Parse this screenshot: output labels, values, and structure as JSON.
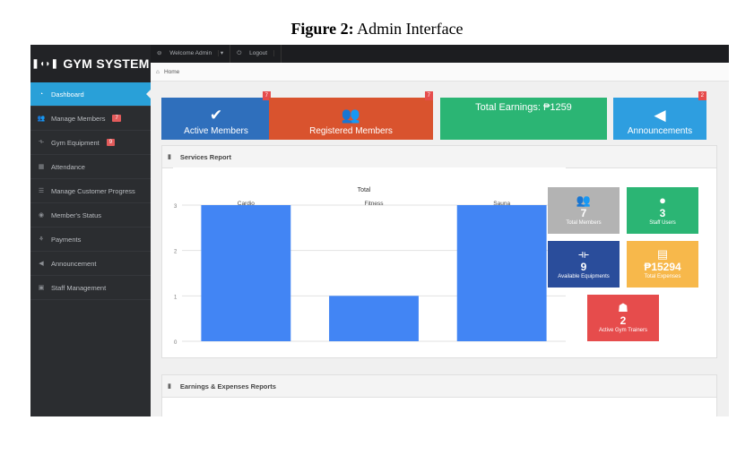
{
  "caption": {
    "label": "Figure 2:",
    "text": "Admin Interface"
  },
  "sidebar": {
    "logo": "GYM SYSTEM",
    "items": [
      {
        "label": "Dashboard",
        "icon": "dashboard-icon",
        "badge": ""
      },
      {
        "label": "Manage Members",
        "icon": "users-icon",
        "badge": "7"
      },
      {
        "label": "Gym Equipment",
        "icon": "dumbbell-icon",
        "badge": "9"
      },
      {
        "label": "Attendance",
        "icon": "calendar-icon",
        "badge": ""
      },
      {
        "label": "Manage Customer Progress",
        "icon": "tasks-icon",
        "badge": ""
      },
      {
        "label": "Member's Status",
        "icon": "eye-icon",
        "badge": ""
      },
      {
        "label": "Payments",
        "icon": "hand-money-icon",
        "badge": ""
      },
      {
        "label": "Announcement",
        "icon": "bullhorn-icon",
        "badge": ""
      },
      {
        "label": "Staff Management",
        "icon": "briefcase-icon",
        "badge": ""
      }
    ]
  },
  "topbar": {
    "welcome": "Welcome Admin",
    "logout": "Logout"
  },
  "breadcrumb": {
    "home": "Home"
  },
  "stats": [
    {
      "label": "Active Members",
      "badge": "7",
      "color": "#2f6fbc",
      "icon": "user-check-icon"
    },
    {
      "label": "Registered Members",
      "badge": "7",
      "color": "#d9532e",
      "icon": "users-icon"
    },
    {
      "label": "Total Earnings: ₱1259",
      "badge": "",
      "color": "#2bb574",
      "icon": ""
    },
    {
      "label": "Announcements",
      "badge": "2",
      "color": "#2e9ee0",
      "icon": "bullhorn-icon"
    }
  ],
  "services_panel": {
    "title": "Services Report"
  },
  "earnings_panel": {
    "title": "Earnings & Expenses Reports"
  },
  "chart_data": {
    "type": "bar",
    "title": "Total",
    "categories": [
      "Cardio",
      "Fitness",
      "Sauna"
    ],
    "values": [
      3,
      1,
      3
    ],
    "yticks": [
      "0",
      "1",
      "2",
      "3"
    ],
    "ylim": [
      0,
      3
    ],
    "bar_color": "#4285f4"
  },
  "tiles": [
    {
      "value": "7",
      "label": "Total Members",
      "color": "#b3b3b3",
      "icon": "users-icon"
    },
    {
      "value": "3",
      "label": "Staff Users",
      "color": "#2bb574",
      "icon": "staff-icon"
    },
    {
      "value": "9",
      "label": "Available Equipments",
      "color": "#2a4d9b",
      "icon": "dumbbell-icon"
    },
    {
      "value": "₱15294",
      "label": "Total Expenses",
      "color": "#f7b84b",
      "icon": "receipt-icon"
    },
    {
      "value": "2",
      "label": "Active Gym Trainers",
      "color": "#e64c4c",
      "icon": "trainer-icon"
    }
  ]
}
